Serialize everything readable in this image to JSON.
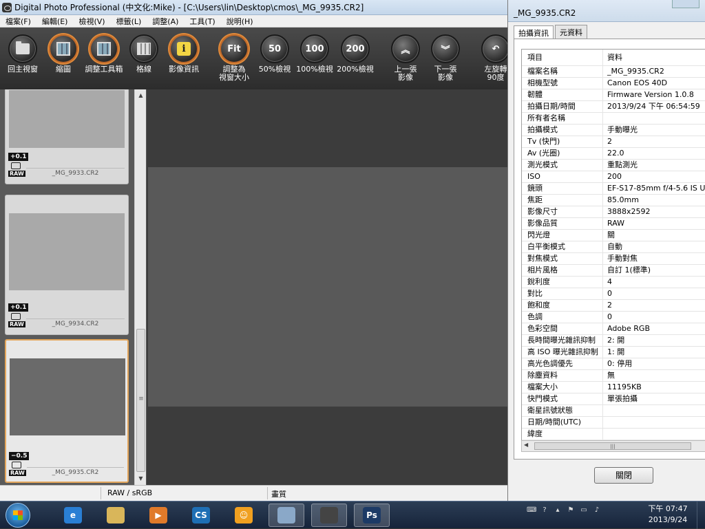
{
  "window": {
    "title": "Digital Photo Professional (中文化:Mike) - [C:\\Users\\lin\\Desktop\\cmos\\_MG_9935.CR2]"
  },
  "menu": [
    "檔案(F)",
    "編輯(E)",
    "檢視(V)",
    "標籤(L)",
    "調整(A)",
    "工具(T)",
    "說明(H)"
  ],
  "toolbar": {
    "items": [
      {
        "label": "回主視窗",
        "icon": "home-folder-icon",
        "glyph": ""
      },
      {
        "label": "縮圖",
        "icon": "thumbnail-icon",
        "glyph": ""
      },
      {
        "label": "調整工具箱",
        "icon": "toolbox-icon",
        "glyph": ""
      },
      {
        "label": "格線",
        "icon": "grid-icon",
        "glyph": ""
      },
      {
        "label": "影像資訊",
        "icon": "info-icon",
        "glyph": "i"
      },
      {
        "label": "調整為\n視窗大小",
        "icon": "fit-window-icon",
        "glyph": "Fit"
      },
      {
        "label": "50%檢視",
        "icon": "zoom-50-icon",
        "glyph": "50"
      },
      {
        "label": "100%檢視",
        "icon": "zoom-100-icon",
        "glyph": "100"
      },
      {
        "label": "200%檢視",
        "icon": "zoom-200-icon",
        "glyph": "200"
      },
      {
        "label": "上一張\n影像",
        "icon": "previous-image-icon",
        "glyph": "︽"
      },
      {
        "label": "下一張\n影像",
        "icon": "next-image-icon",
        "glyph": "︾"
      },
      {
        "label": "左旋轉\n90度",
        "icon": "rotate-left-icon",
        "glyph": "↶"
      }
    ]
  },
  "thumbnails": [
    {
      "file": "_MG_9933.CR2",
      "exposure": "+0.1",
      "format": "RAW",
      "selected": false
    },
    {
      "file": "_MG_9934.CR2",
      "exposure": "+0.1",
      "format": "RAW",
      "selected": false
    },
    {
      "file": "_MG_9935.CR2",
      "exposure": "−0.5",
      "format": "RAW",
      "selected": true
    }
  ],
  "status": {
    "color_space": "RAW / sRGB",
    "quality": "畫質"
  },
  "info_window": {
    "title": "_MG_9935.CR2",
    "tabs": [
      "拍攝資訊",
      "元資料"
    ],
    "columns": [
      "項目",
      "資料"
    ],
    "rows": [
      [
        "檔案名稱",
        "_MG_9935.CR2"
      ],
      [
        "相機型號",
        "Canon EOS 40D"
      ],
      [
        "韌體",
        "Firmware Version 1.0.8"
      ],
      [
        "拍攝日期/時間",
        "2013/9/24 下午 06:54:59"
      ],
      [
        "所有者名稱",
        ""
      ],
      [
        "拍攝模式",
        "手動曝光"
      ],
      [
        "Tv (快門)",
        "2"
      ],
      [
        "Av (光圈)",
        "22.0"
      ],
      [
        "測光模式",
        "重點測光"
      ],
      [
        "ISO",
        "200"
      ],
      [
        "鏡頭",
        "EF-S17-85mm f/4-5.6 IS USM"
      ],
      [
        "焦距",
        "85.0mm"
      ],
      [
        "影像尺寸",
        "3888x2592"
      ],
      [
        "影像品質",
        "RAW"
      ],
      [
        "閃光燈",
        "關"
      ],
      [
        "白平衡模式",
        "自動"
      ],
      [
        "對焦模式",
        "手動對焦"
      ],
      [
        "相片風格",
        "自訂 1(標準)"
      ],
      [
        "銳利度",
        "4"
      ],
      [
        "對比",
        "0"
      ],
      [
        "飽和度",
        "2"
      ],
      [
        "色調",
        "0"
      ],
      [
        "色彩空間",
        "Adobe RGB"
      ],
      [
        "長時間曝光雜訊抑制",
        "2: 開"
      ],
      [
        "高 ISO 曝光雜訊抑制",
        "1: 開"
      ],
      [
        "高光色調優先",
        "0: 停用"
      ],
      [
        "除塵資料",
        "無"
      ],
      [
        "檔案大小",
        "11195KB"
      ],
      [
        "快門模式",
        "單張拍攝"
      ],
      [
        "衛星訊號狀態",
        ""
      ],
      [
        "日期/時間(UTC)",
        ""
      ],
      [
        "緯度",
        ""
      ]
    ],
    "close_label": "關閉"
  },
  "taskbar": {
    "apps": [
      {
        "name": "ie-icon",
        "glyph": "e",
        "color": "#2a7fd4"
      },
      {
        "name": "explorer-icon",
        "glyph": "",
        "color": "#d9b65a"
      },
      {
        "name": "media-player-icon",
        "glyph": "▶",
        "color": "#e07a2a"
      },
      {
        "name": "cs-app-icon",
        "glyph": "CS",
        "color": "#1e6fb5"
      },
      {
        "name": "pps-app-icon",
        "glyph": "☺",
        "color": "#f0a020"
      },
      {
        "name": "paint-icon",
        "glyph": "",
        "color": "#8aa8c8"
      },
      {
        "name": "dpp-app-icon",
        "glyph": "",
        "color": "#444444"
      },
      {
        "name": "photoshop-icon",
        "glyph": "Ps",
        "color": "#1c3a66"
      }
    ],
    "time": "下午 07:47",
    "date": "2013/9/24"
  }
}
